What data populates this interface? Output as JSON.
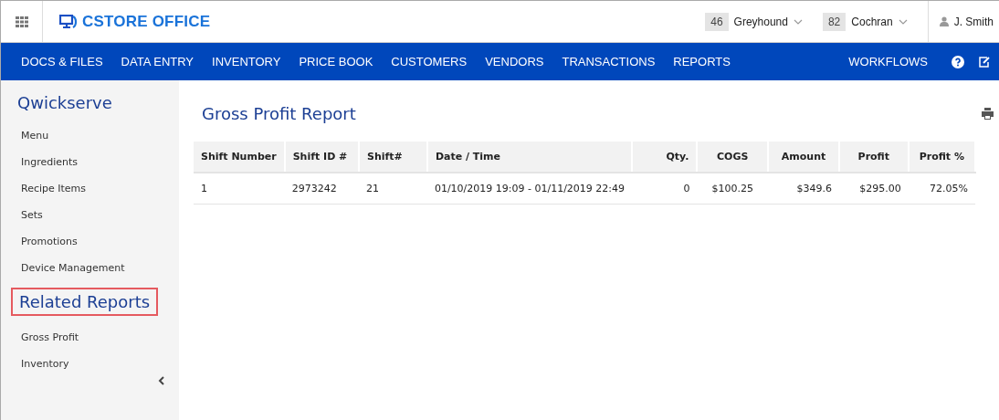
{
  "header": {
    "logo": "CSTORE OFFICE",
    "stores": [
      {
        "number": "46",
        "name": "Greyhound"
      },
      {
        "number": "82",
        "name": "Cochran"
      }
    ],
    "user": "J. Smith"
  },
  "nav": {
    "items": [
      "DOCS & FILES",
      "DATA ENTRY",
      "INVENTORY",
      "PRICE BOOK",
      "CUSTOMERS",
      "VENDORS",
      "TRANSACTIONS",
      "REPORTS"
    ],
    "right": "WORKFLOWS"
  },
  "sidebar": {
    "title": "Qwickserve",
    "items": [
      "Menu",
      "Ingredients",
      "Recipe Items",
      "Sets",
      "Promotions",
      "Device Management"
    ],
    "section": {
      "title": "Related Reports",
      "highlighted": true,
      "items": [
        "Gross Profit",
        "Inventory"
      ]
    }
  },
  "report": {
    "title": "Gross Profit Report",
    "table": {
      "columns": [
        "Shift Number",
        "Shift ID #",
        "Shift#",
        "Date / Time",
        "Qty.",
        "COGS",
        "Amount",
        "Profit",
        "Profit %"
      ],
      "rows": [
        [
          "1",
          "2973242",
          "21",
          "01/10/2019 19:09 - 01/11/2019 22:49",
          "0",
          "$100.25",
          "$349.6",
          "$295.00",
          "72.05%"
        ]
      ]
    }
  }
}
